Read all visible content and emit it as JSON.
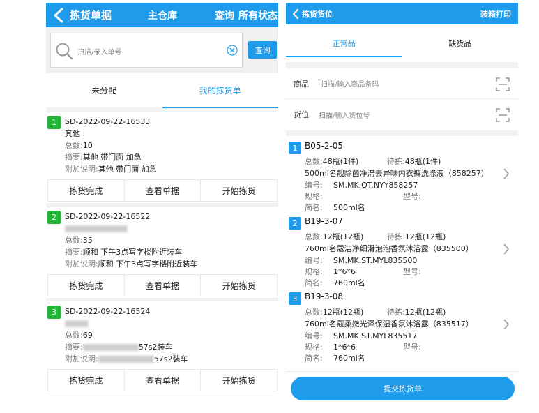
{
  "left": {
    "header": {
      "title": "拣货单据",
      "warehouse": "主仓库",
      "query": "查询",
      "status": "所有状态"
    },
    "search": {
      "placeholder": "扫描/录入单号",
      "button": "查询"
    },
    "tabs": [
      {
        "label": "未分配"
      },
      {
        "label": "我的拣货单"
      }
    ],
    "actions": {
      "complete": "拣货完成",
      "view": "查看单据",
      "start": "开始拣货"
    },
    "cards": [
      {
        "index": "1",
        "id": "SD-2022-09-22-16533",
        "customer": "其他",
        "total_key": "总数:",
        "total": "10",
        "summary_key": "摘要:",
        "summary": "其他 带门面  加急",
        "note_key": "附加说明:",
        "note": "其他 带门面  加急"
      },
      {
        "index": "2",
        "id": "SD-2022-09-22-16522",
        "total_key": "总数:",
        "total": "35",
        "summary_key": "摘要:",
        "summary": "顺和 下午3点写字楼附近装车",
        "note_key": "附加说明:",
        "note": "顺和 下午3点写字楼附近装车"
      },
      {
        "index": "3",
        "id": "SD-2022-09-22-16524",
        "total_key": "总数:",
        "total": "69",
        "summary_key": "摘要:",
        "summary_tail": "57s2装车",
        "note_key": "附加说明:",
        "note_tail": "57s2装车"
      }
    ]
  },
  "right": {
    "header": {
      "title": "拣货货位",
      "pack": "装箱打印"
    },
    "tabs": [
      {
        "label": "正常品"
      },
      {
        "label": "缺货品"
      }
    ],
    "fields": {
      "product_label": "商品",
      "product_placeholder": "扫描/输入商品条码",
      "location_label": "货位",
      "location_placeholder": "扫描/输入货位号"
    },
    "labels": {
      "total": "总数:",
      "pending": "待拣:",
      "code": "编号:",
      "spec": "规格:",
      "model": "型号:",
      "short": "简名:"
    },
    "items": [
      {
        "index": "1",
        "location": "B05-2-05",
        "total": "48瓶(1件)",
        "pending": "48瓶(1件)",
        "name": "500ml名靓除菌净滞去异味内衣裤洗涤液（858257）",
        "code": "SM.MK.QT.NYY858257",
        "spec": "",
        "model": "",
        "short": "500ml名"
      },
      {
        "index": "2",
        "location": "B19-3-07",
        "total": "12瓶(12瓶)",
        "pending": "12瓶(12瓶)",
        "name": "760ml名蔻洁净细滑泡泡香氛沐浴露（835500）",
        "code": "SM.MK.ST.MYL835500",
        "spec": "1*6*6",
        "model": "",
        "short": "760ml名"
      },
      {
        "index": "3",
        "location": "B19-3-08",
        "total": "12瓶(12瓶)",
        "pending": "12瓶(12瓶)",
        "name": "760ml名蔻柔嫩光泽保湿香氛沐浴露（835517）",
        "code": "SM.MK.ST.MYL835517",
        "spec": "1*6*6",
        "model": "",
        "short": "760ml名"
      }
    ],
    "submit": "提交拣货单"
  }
}
